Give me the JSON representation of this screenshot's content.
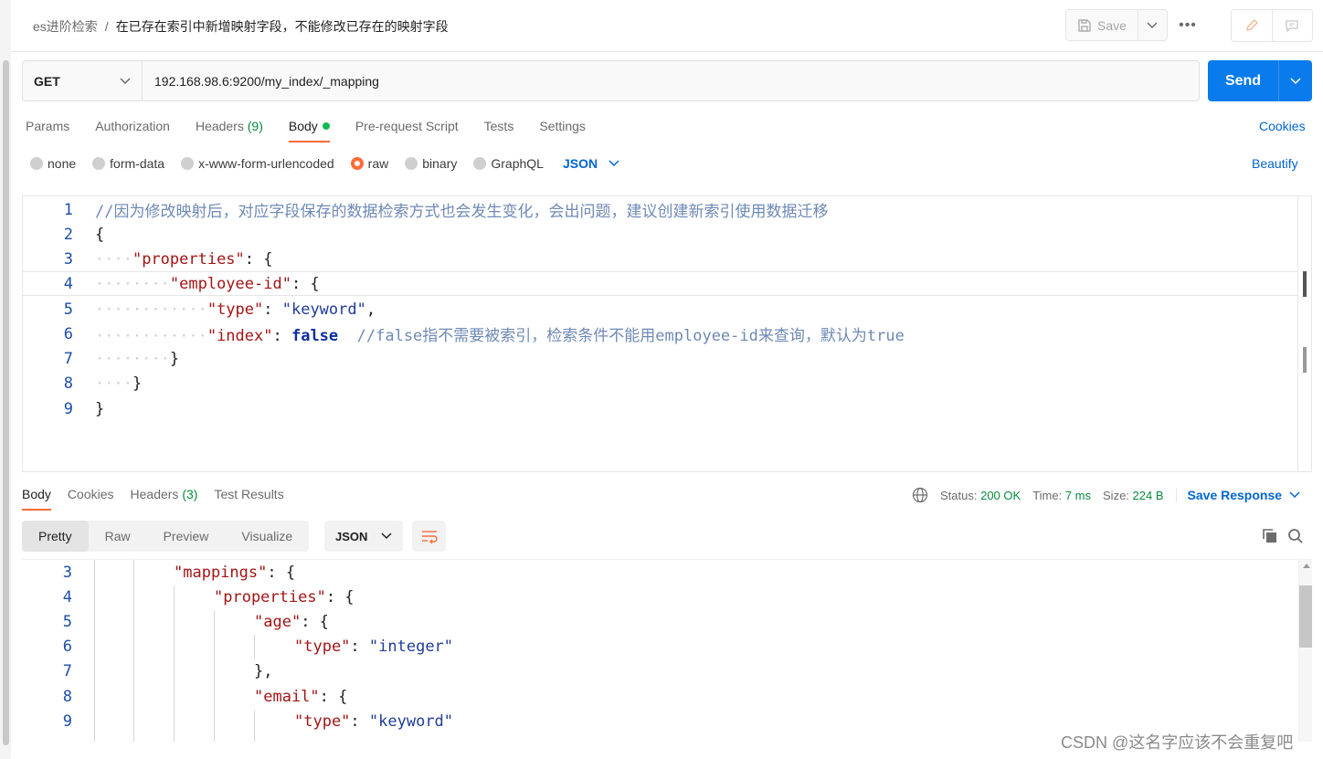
{
  "header": {
    "breadcrumb_parent": "es进阶检索",
    "breadcrumb_sep": "/",
    "breadcrumb_current": "在已存在索引中新增映射字段，不能修改已存在的映射字段",
    "save_label": "Save",
    "more_label": "•••"
  },
  "request": {
    "method": "GET",
    "url": "192.168.98.6:9200/my_index/_mapping",
    "send_label": "Send"
  },
  "req_tabs": {
    "params": "Params",
    "authorization": "Authorization",
    "headers": "Headers",
    "headers_count": "(9)",
    "body": "Body",
    "prerequest": "Pre-request Script",
    "tests": "Tests",
    "settings": "Settings",
    "cookies": "Cookies"
  },
  "body_options": {
    "none": "none",
    "form_data": "form-data",
    "urlencoded": "x-www-form-urlencoded",
    "raw": "raw",
    "binary": "binary",
    "graphql": "GraphQL",
    "format": "JSON",
    "beautify": "Beautify"
  },
  "request_body": {
    "l1": "//因为修改映射后，对应字段保存的数据检索方式也会发生变化，会出问题，建议创建新索引使用数据迁移",
    "l2": "{",
    "l3_key": "\"properties\"",
    "l3_rest": ": {",
    "l4_key": "\"employee-id\"",
    "l4_rest": ": {",
    "l5_key": "\"type\"",
    "l5_val": "\"keyword\"",
    "l6_key": "\"index\"",
    "l6_val": "false",
    "l6_comment": "//false指不需要被索引，检索条件不能用employee-id来查询，默认为true",
    "l7": "}",
    "l8": "}",
    "l9": "}"
  },
  "response_tabs": {
    "body": "Body",
    "cookies": "Cookies",
    "headers": "Headers",
    "headers_count": "(3)",
    "test_results": "Test Results"
  },
  "response_status": {
    "status_label": "Status:",
    "status_value": "200 OK",
    "time_label": "Time:",
    "time_value": "7 ms",
    "size_label": "Size:",
    "size_value": "224 B",
    "save_response": "Save Response"
  },
  "view_tabs": {
    "pretty": "Pretty",
    "raw": "Raw",
    "preview": "Preview",
    "visualize": "Visualize",
    "format": "JSON"
  },
  "response_body": {
    "l3_key": "\"mappings\"",
    "l4_key": "\"properties\"",
    "l5_key": "\"age\"",
    "l6_key": "\"type\"",
    "l6_val": "\"integer\"",
    "l7": "},",
    "l8_key": "\"email\"",
    "l9_key": "\"type\"",
    "l9_val": "\"keyword\""
  },
  "watermark": "CSDN @这名字应该不会重复吧",
  "colors": {
    "accent": "#ff6c37",
    "send": "#097bed",
    "link": "#0265d2",
    "success": "#0a8a3e"
  }
}
